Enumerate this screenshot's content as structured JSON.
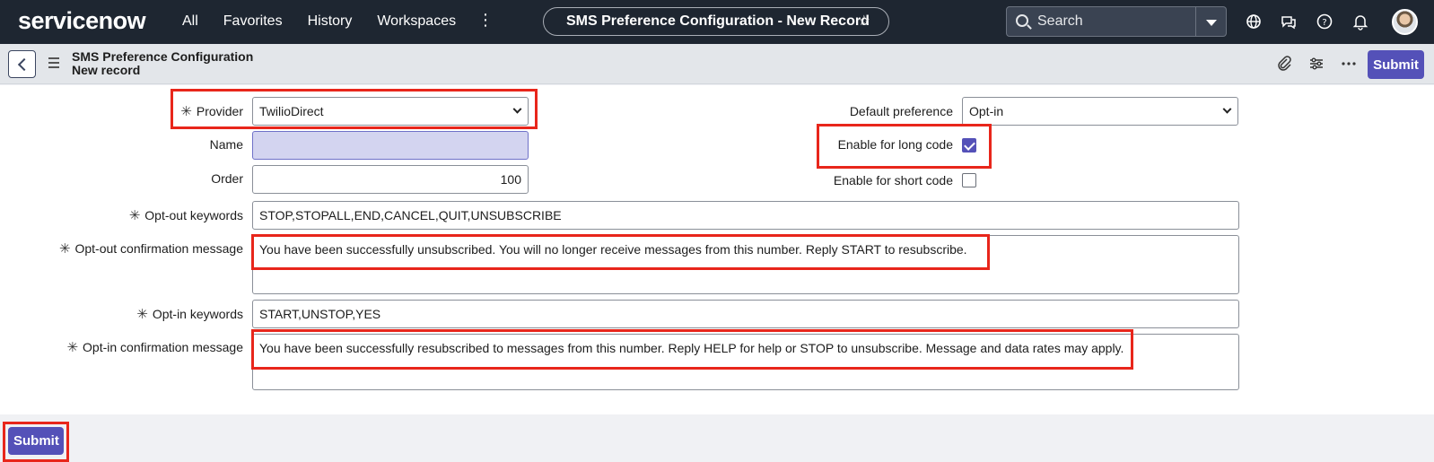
{
  "topnav": {
    "logo_text": "servicenow",
    "menu": [
      "All",
      "Favorites",
      "History",
      "Workspaces"
    ],
    "more_glyph": "⋮",
    "record_title": "SMS Preference Configuration - New Record",
    "star_glyph": "☆",
    "search_label": "Search",
    "icons": [
      "globe-icon",
      "chat-icon",
      "help-icon",
      "bell-icon",
      "user-avatar"
    ]
  },
  "subheader": {
    "title_line1": "SMS Preference Configuration",
    "title_line2": "New record",
    "icons": [
      "paperclip-icon",
      "settings-sliders-icon",
      "more-icon"
    ],
    "submit_label": "Submit"
  },
  "form": {
    "provider": {
      "label": "Provider",
      "required": true,
      "value": "TwilioDirect"
    },
    "name": {
      "label": "Name",
      "value": ""
    },
    "order": {
      "label": "Order",
      "value": "100"
    },
    "default_preference": {
      "label": "Default preference",
      "value": "Opt-in"
    },
    "enable_long_code": {
      "label": "Enable for long code",
      "checked": true
    },
    "enable_short_code": {
      "label": "Enable for short code",
      "checked": false
    },
    "opt_out_keywords": {
      "label": "Opt-out keywords",
      "required": true,
      "value": "STOP,STOPALL,END,CANCEL,QUIT,UNSUBSCRIBE"
    },
    "opt_out_message": {
      "label": "Opt-out confirmation message",
      "required": true,
      "value": "You have been successfully unsubscribed. You will no longer receive messages from this number. Reply START to resubscribe."
    },
    "opt_in_keywords": {
      "label": "Opt-in keywords",
      "required": true,
      "value": "START,UNSTOP,YES"
    },
    "opt_in_message": {
      "label": "Opt-in confirmation message",
      "required": true,
      "value": "You have been successfully resubscribed to messages from this number. Reply HELP for help or STOP to unsubscribe. Message and data rates may apply."
    },
    "required_glyph": "✳"
  },
  "footer": {
    "submit_label": "Submit"
  },
  "colors": {
    "nav_bg": "#1e2631",
    "accent": "#5451b8",
    "highlight": "#e8261b",
    "name_field_bg": "#d3d4f0"
  }
}
